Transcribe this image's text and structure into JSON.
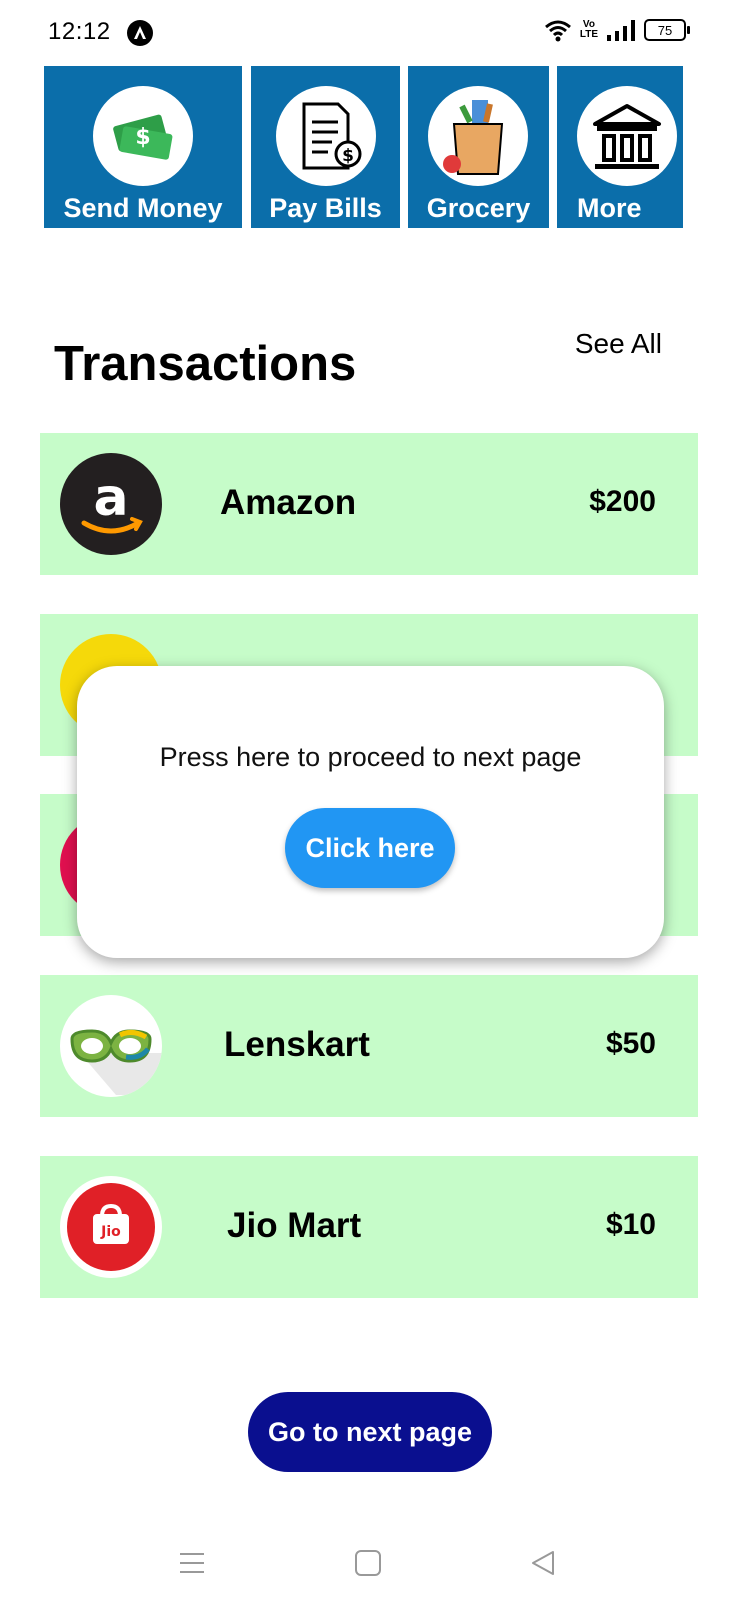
{
  "status_bar": {
    "time": "12:12",
    "notification_icon": "app-notification-icon",
    "volte_label_top": "Vo",
    "volte_label_bottom": "LTE",
    "battery_level": "75"
  },
  "quick_actions": [
    {
      "label": "Send Money",
      "icon": "money-icon"
    },
    {
      "label": "Pay Bills",
      "icon": "bill-icon"
    },
    {
      "label": "Grocery",
      "icon": "grocery-bag-icon"
    },
    {
      "label": "More",
      "icon": "bank-icon"
    }
  ],
  "transactions": {
    "title": "Transactions",
    "see_all": "See All",
    "items": [
      {
        "name": "Amazon",
        "amount": "$200",
        "logo": "amazon-logo",
        "logo_text": "a"
      },
      {
        "name": "",
        "amount": "",
        "logo": "yellow-logo"
      },
      {
        "name": "",
        "amount": "",
        "logo": "pink-logo"
      },
      {
        "name": "Lenskart",
        "amount": "$50",
        "logo": "lenskart-logo"
      },
      {
        "name": "Jio Mart",
        "amount": "$10",
        "logo": "jiomart-logo",
        "logo_text": "Jio"
      }
    ]
  },
  "dialog": {
    "message": "Press here to proceed to next page",
    "button_label": "Click here"
  },
  "next_button": {
    "label": "Go to next page"
  },
  "colors": {
    "quick_action_bg": "#0B6EAA",
    "row_bg": "#C6FCC9",
    "dialog_button": "#2196F3",
    "next_button": "#0A0F8F"
  }
}
